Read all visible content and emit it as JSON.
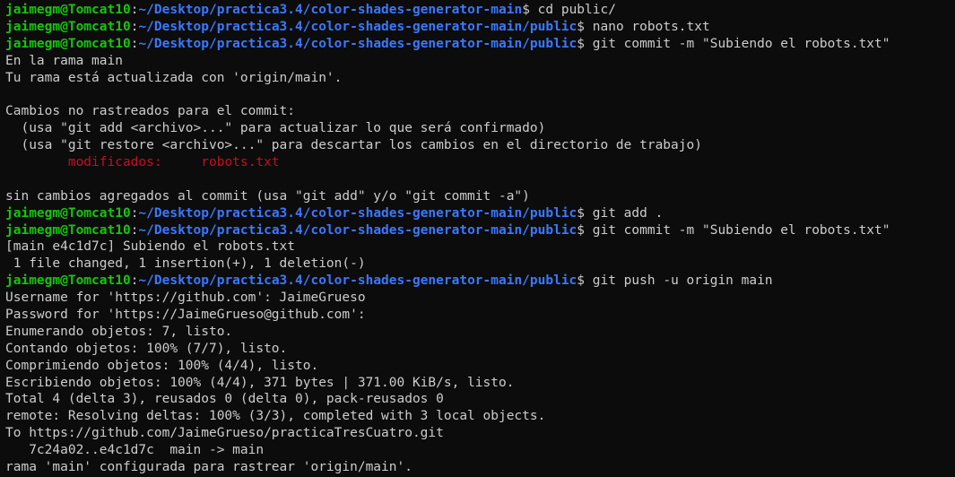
{
  "terminal": {
    "lines": [
      {
        "type": "prompt",
        "user": "jaimegm@Tomcat10",
        "path": "~/Desktop/practica3.4/color-shades-generator-main",
        "command": "cd public/"
      },
      {
        "type": "prompt",
        "user": "jaimegm@Tomcat10",
        "path": "~/Desktop/practica3.4/color-shades-generator-main/public",
        "command": "nano robots.txt"
      },
      {
        "type": "prompt",
        "user": "jaimegm@Tomcat10",
        "path": "~/Desktop/practica3.4/color-shades-generator-main/public",
        "command": "git commit -m \"Subiendo el robots.txt\""
      },
      {
        "type": "output",
        "text": "En la rama main"
      },
      {
        "type": "output",
        "text": "Tu rama está actualizada con 'origin/main'."
      },
      {
        "type": "output",
        "text": ""
      },
      {
        "type": "output",
        "text": "Cambios no rastreados para el commit:"
      },
      {
        "type": "output",
        "text": "  (usa \"git add <archivo>...\" para actualizar lo que será confirmado)"
      },
      {
        "type": "output",
        "text": "  (usa \"git restore <archivo>...\" para descartar los cambios en el directorio de trabajo)"
      },
      {
        "type": "modified",
        "indent": "        ",
        "label": "modificados:",
        "gap": "     ",
        "file": "robots.txt"
      },
      {
        "type": "output",
        "text": ""
      },
      {
        "type": "output",
        "text": "sin cambios agregados al commit (usa \"git add\" y/o \"git commit -a\")"
      },
      {
        "type": "prompt",
        "user": "jaimegm@Tomcat10",
        "path": "~/Desktop/practica3.4/color-shades-generator-main/public",
        "command": "git add ."
      },
      {
        "type": "prompt",
        "user": "jaimegm@Tomcat10",
        "path": "~/Desktop/practica3.4/color-shades-generator-main/public",
        "command": "git commit -m \"Subiendo el robots.txt\""
      },
      {
        "type": "output",
        "text": "[main e4c1d7c] Subiendo el robots.txt"
      },
      {
        "type": "output",
        "text": " 1 file changed, 1 insertion(+), 1 deletion(-)"
      },
      {
        "type": "prompt",
        "user": "jaimegm@Tomcat10",
        "path": "~/Desktop/practica3.4/color-shades-generator-main/public",
        "command": "git push -u origin main"
      },
      {
        "type": "output",
        "text": "Username for 'https://github.com': JaimeGrueso"
      },
      {
        "type": "output",
        "text": "Password for 'https://JaimeGrueso@github.com':"
      },
      {
        "type": "output",
        "text": "Enumerando objetos: 7, listo."
      },
      {
        "type": "output",
        "text": "Contando objetos: 100% (7/7), listo."
      },
      {
        "type": "output",
        "text": "Comprimiendo objetos: 100% (4/4), listo."
      },
      {
        "type": "output",
        "text": "Escribiendo objetos: 100% (4/4), 371 bytes | 371.00 KiB/s, listo."
      },
      {
        "type": "output",
        "text": "Total 4 (delta 3), reusados 0 (delta 0), pack-reusados 0"
      },
      {
        "type": "output",
        "text": "remote: Resolving deltas: 100% (3/3), completed with 3 local objects."
      },
      {
        "type": "output",
        "text": "To https://github.com/JaimeGrueso/practicaTresCuatro.git"
      },
      {
        "type": "output",
        "text": "   7c24a02..e4c1d7c  main -> main"
      },
      {
        "type": "output",
        "text": "rama 'main' configurada para rastrear 'origin/main'."
      }
    ]
  },
  "colors": {
    "background": "#0c0c0c",
    "text": "#cccccc",
    "user": "#16c60c",
    "path": "#3b78ff",
    "modified": "#c50f1f"
  }
}
